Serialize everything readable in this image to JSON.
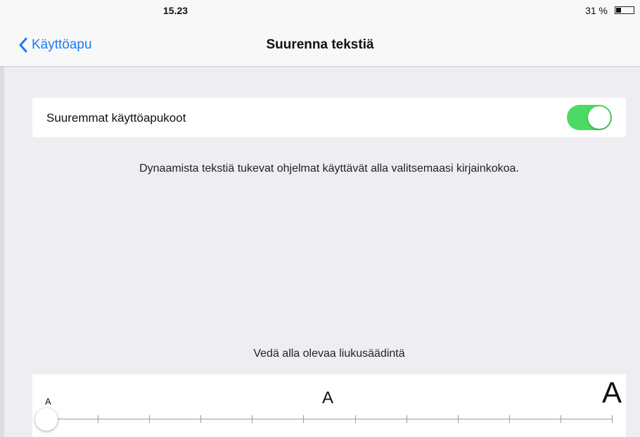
{
  "status_bar": {
    "time": "15.23",
    "battery_text": "31 %",
    "battery_level": 0.31
  },
  "nav": {
    "back_label": "Käyttöapu",
    "title": "Suurenna tekstiä"
  },
  "larger_sizes": {
    "label": "Suuremmat käyttöapukoot",
    "enabled": true
  },
  "description": "Dynaamista tekstiä tukevat ohjelmat käyttävät alla valitsemaasi kirjainkokoa.",
  "slider": {
    "hint": "Vedä alla olevaa liukusäädintä",
    "small_label": "A",
    "medium_label": "A",
    "large_label": "A",
    "steps": 12,
    "selected_step": 0
  },
  "colors": {
    "accent": "#1a7cf5",
    "toggle_on": "#4cd964",
    "background": "#eeeef2"
  }
}
